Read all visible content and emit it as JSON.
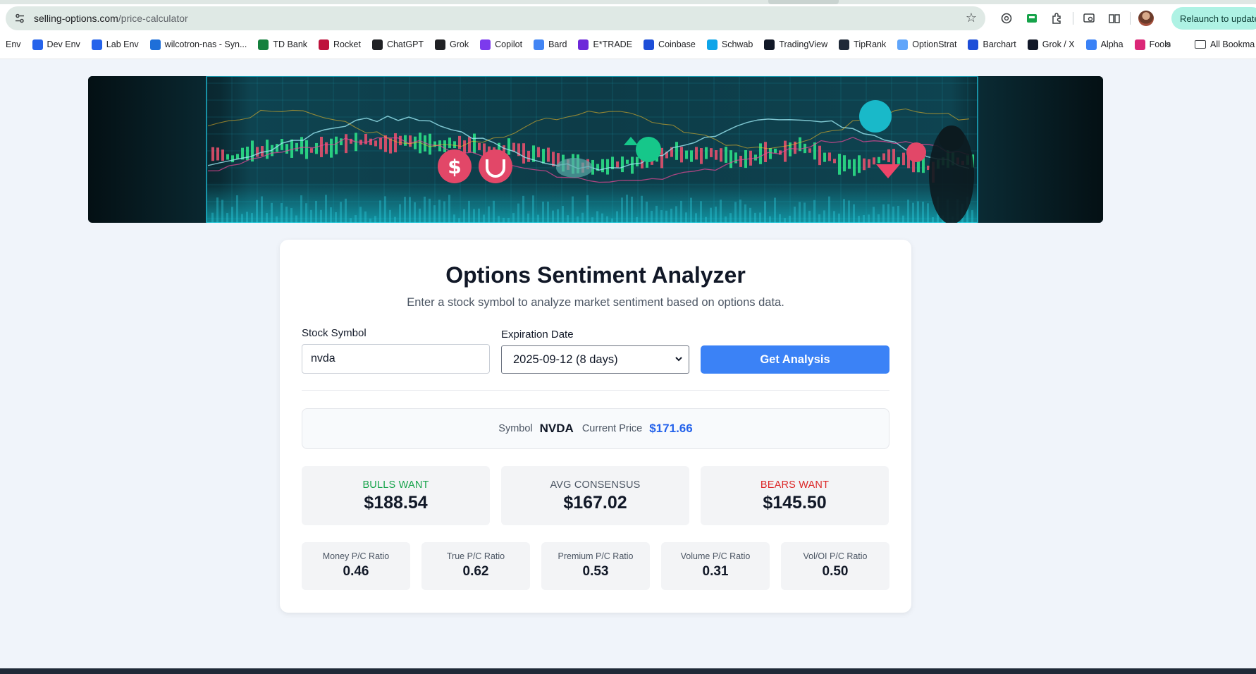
{
  "browser": {
    "url_domain": "selling-options.com",
    "url_path": "/price-calculator",
    "relaunch_label": "Relaunch to update",
    "bookmarks": [
      {
        "label": "Env",
        "icon": "none",
        "color": ""
      },
      {
        "label": "Dev Env",
        "icon": "so-favicon",
        "color": "#2563eb"
      },
      {
        "label": "Lab Env",
        "icon": "so-favicon",
        "color": "#2563eb"
      },
      {
        "label": "wilcotron-nas - Syn...",
        "icon": "dsm-favicon",
        "color": "#1e6fd9"
      },
      {
        "label": "TD Bank",
        "icon": "td-favicon",
        "color": "#15803d"
      },
      {
        "label": "Rocket",
        "icon": "rocket-favicon",
        "color": "#be123c"
      },
      {
        "label": "ChatGPT",
        "icon": "chatgpt-favicon",
        "color": "#202124"
      },
      {
        "label": "Grok",
        "icon": "grok-favicon",
        "color": "#202124"
      },
      {
        "label": "Copilot",
        "icon": "copilot-favicon",
        "color": "#7c3aed"
      },
      {
        "label": "Bard",
        "icon": "bard-favicon",
        "color": "#4285f4"
      },
      {
        "label": "E*TRADE",
        "icon": "etrade-favicon",
        "color": "#6d28d9"
      },
      {
        "label": "Coinbase",
        "icon": "coinbase-favicon",
        "color": "#1d4ed8"
      },
      {
        "label": "Schwab",
        "icon": "schwab-favicon",
        "color": "#0ea5e9"
      },
      {
        "label": "TradingView",
        "icon": "tradingview-favicon",
        "color": "#111827"
      },
      {
        "label": "TipRank",
        "icon": "tipranks-favicon",
        "color": "#1f2937"
      },
      {
        "label": "OptionStrat",
        "icon": "optionstrat-favicon",
        "color": "#60a5fa"
      },
      {
        "label": "Barchart",
        "icon": "barchart-favicon",
        "color": "#1d4ed8"
      },
      {
        "label": "Grok / X",
        "icon": "x-favicon",
        "color": "#111827"
      },
      {
        "label": "Alpha",
        "icon": "alpha-favicon",
        "color": "#3b82f6"
      },
      {
        "label": "Fools",
        "icon": "fools-favicon",
        "color": "#db2777"
      }
    ],
    "more_label": "»",
    "all_bookmarks_label": "All Bookma"
  },
  "app": {
    "title": "Options Sentiment Analyzer",
    "subtitle": "Enter a stock symbol to analyze market sentiment based on options data.",
    "symbol_label": "Stock Symbol",
    "symbol_value": "nvda",
    "expiration_label": "Expiration Date",
    "expiration_value": "2025-09-12 (8 days)",
    "button_label": "Get Analysis",
    "summary": {
      "symbol_label": "Symbol",
      "symbol": "NVDA",
      "price_label": "Current Price",
      "price": "$171.66"
    },
    "targets": {
      "bulls_label": "BULLS WANT",
      "bulls_value": "$188.54",
      "avg_label": "AVG CONSENSUS",
      "avg_value": "$167.02",
      "bears_label": "BEARS WANT",
      "bears_value": "$145.50"
    },
    "ratios": [
      {
        "label": "Money P/C Ratio",
        "value": "0.46"
      },
      {
        "label": "True P/C Ratio",
        "value": "0.62"
      },
      {
        "label": "Premium P/C Ratio",
        "value": "0.53"
      },
      {
        "label": "Volume P/C Ratio",
        "value": "0.31"
      },
      {
        "label": "Vol/OI P/C Ratio",
        "value": "0.50"
      }
    ]
  },
  "colors": {
    "accent": "#3b82f6",
    "bull": "#16a34a",
    "bear": "#dc2626",
    "price": "#2563eb"
  }
}
